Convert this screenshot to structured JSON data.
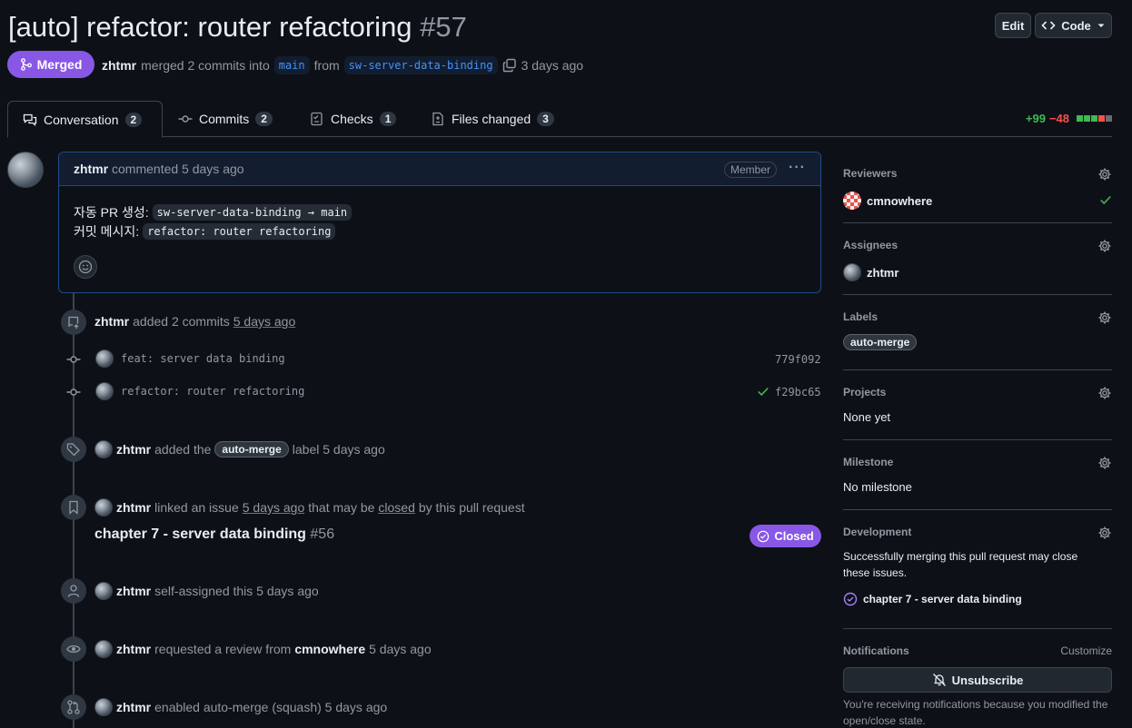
{
  "header": {
    "title": "[auto] refactor: router refactoring",
    "number": "#57",
    "edit_label": "Edit",
    "code_label": "Code"
  },
  "status": {
    "state": "Merged",
    "author": "zhtmr",
    "merged_text": "merged 2 commits into",
    "base_branch": "main",
    "from_text": "from",
    "head_branch": "sw-server-data-binding",
    "time": "3 days ago"
  },
  "tabs": [
    {
      "label": "Conversation",
      "count": "2"
    },
    {
      "label": "Commits",
      "count": "2"
    },
    {
      "label": "Checks",
      "count": "1"
    },
    {
      "label": "Files changed",
      "count": "3"
    }
  ],
  "diffstat": {
    "additions": "+99",
    "deletions": "−48"
  },
  "comment": {
    "author": "zhtmr",
    "meta": "commented 5 days ago",
    "role": "Member",
    "line1_label": "자동 PR 생성:",
    "line1_code": "sw-server-data-binding → main",
    "line2_label": "커밋 메시지:",
    "line2_code": "refactor: router refactoring"
  },
  "timeline": {
    "commits_event": {
      "user": "zhtmr",
      "text": "added 2 commits",
      "time": "5 days ago"
    },
    "commits": [
      {
        "message": "feat: server data binding",
        "sha": "779f092"
      },
      {
        "message": "refactor: router refactoring",
        "sha": "f29bc65"
      }
    ],
    "label_event": {
      "user": "zhtmr",
      "text_before": "added the",
      "label": "auto-merge",
      "text_after": "label 5 days ago"
    },
    "link_event": {
      "user": "zhtmr",
      "text1": "linked an issue",
      "time": "5 days ago",
      "text2": "that may be",
      "closed_word": "closed",
      "text3": "by this pull request"
    },
    "linked_issue": {
      "title": "chapter 7 - server data binding",
      "number": "#56",
      "state": "Closed"
    },
    "assign_event": {
      "user": "zhtmr",
      "text": "self-assigned this 5 days ago"
    },
    "review_event": {
      "user": "zhtmr",
      "text": "requested a review from",
      "reviewer": "cmnowhere",
      "time": "5 days ago"
    },
    "automerge_event": {
      "user": "zhtmr",
      "text": "enabled auto-merge (squash) 5 days ago"
    }
  },
  "sidebar": {
    "reviewers": {
      "heading": "Reviewers",
      "name": "cmnowhere"
    },
    "assignees": {
      "heading": "Assignees",
      "name": "zhtmr"
    },
    "labels": {
      "heading": "Labels",
      "label": "auto-merge"
    },
    "projects": {
      "heading": "Projects",
      "value": "None yet"
    },
    "milestone": {
      "heading": "Milestone",
      "value": "No milestone"
    },
    "development": {
      "heading": "Development",
      "text": "Successfully merging this pull request may close these issues.",
      "issue": "chapter 7 - server data binding"
    },
    "notifications": {
      "heading": "Notifications",
      "customize": "Customize",
      "button": "Unsubscribe",
      "reason": "You're receiving notifications because you modified the open/close state."
    }
  },
  "colors": {
    "accent_purple": "#8957e5",
    "link_blue": "#4493f8",
    "success_green": "#3fb950",
    "danger_red": "#f85149"
  }
}
